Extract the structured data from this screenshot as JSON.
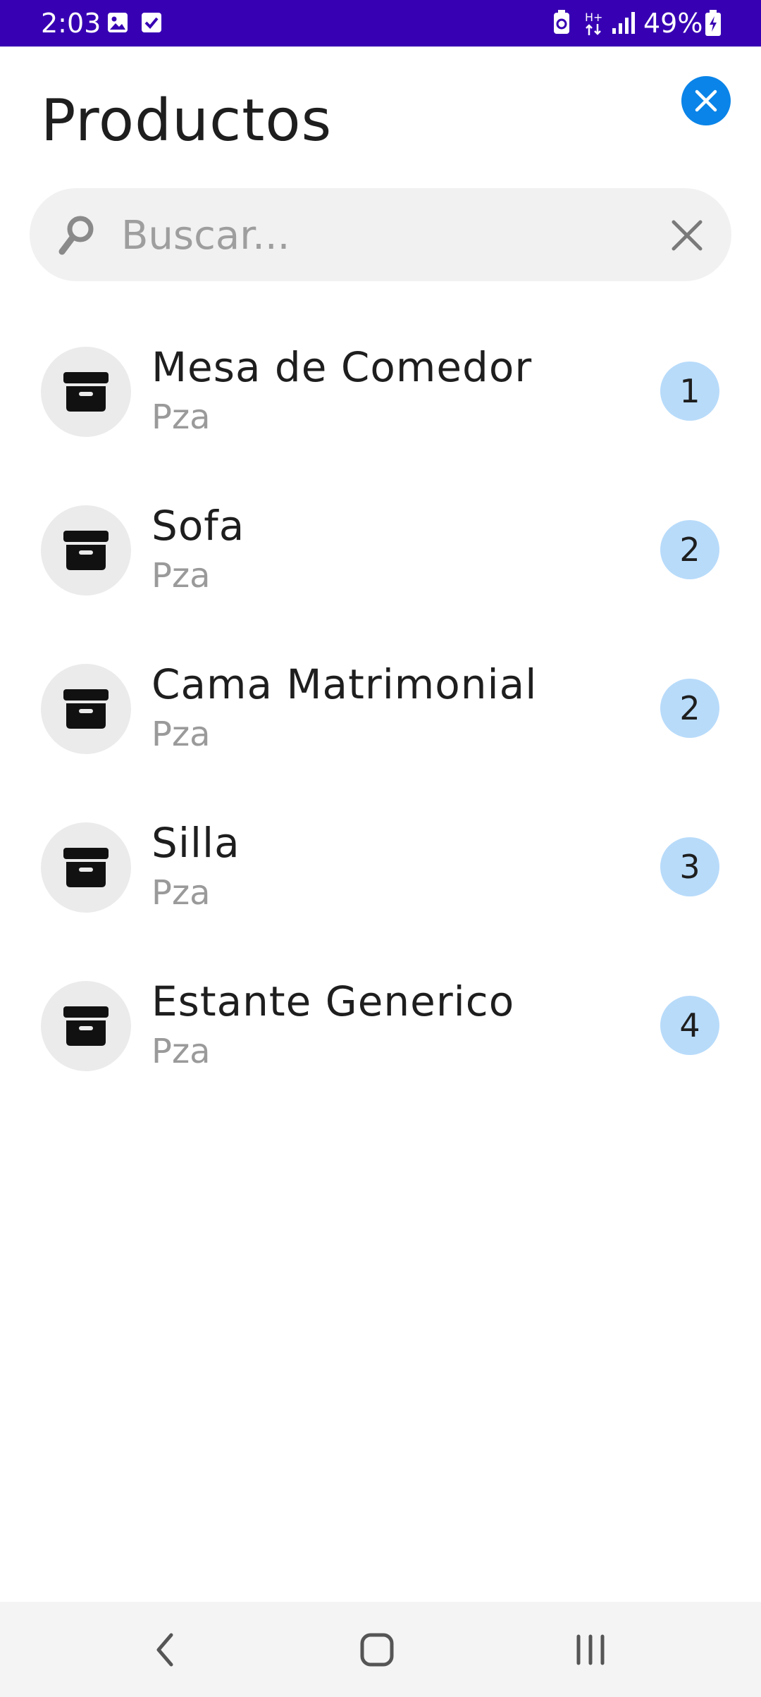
{
  "status_bar": {
    "time": "2:03",
    "battery": "49%",
    "network": "H+",
    "icons": [
      "gallery-icon",
      "checkbox-icon",
      "recycle-icon",
      "data-arrows-icon",
      "signal-icon",
      "battery-charging-icon"
    ]
  },
  "header": {
    "title": "Productos",
    "close_icon": "close-icon"
  },
  "search": {
    "placeholder": "Buscar...",
    "value": ""
  },
  "products": [
    {
      "name": "Mesa de Comedor",
      "unit": "Pza",
      "count": "1"
    },
    {
      "name": "Sofa",
      "unit": "Pza",
      "count": "2"
    },
    {
      "name": "Cama Matrimonial",
      "unit": "Pza",
      "count": "2"
    },
    {
      "name": "Silla",
      "unit": "Pza",
      "count": "3"
    },
    {
      "name": "Estante Generico",
      "unit": "Pza",
      "count": "4"
    }
  ],
  "colors": {
    "status_bar": "#3700b3",
    "accent": "#0a84e8",
    "badge": "#b8dbfa"
  },
  "nav": [
    "back-icon",
    "home-icon",
    "recents-icon"
  ]
}
